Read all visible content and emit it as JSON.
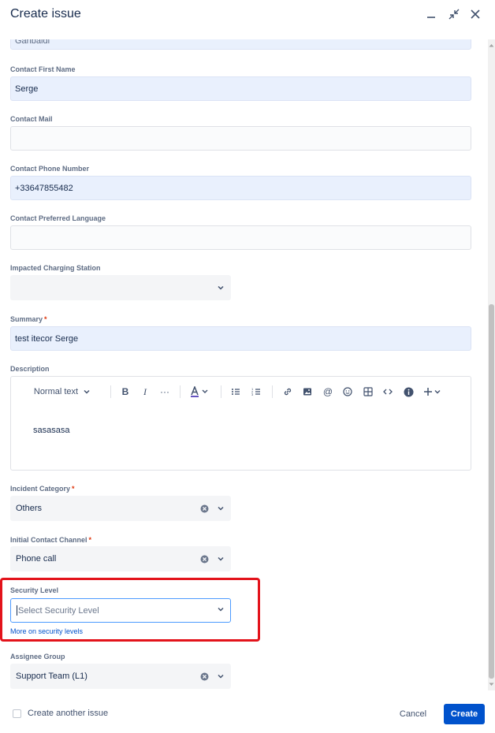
{
  "dialog": {
    "title": "Create issue"
  },
  "fields": {
    "partial_value": "Garibaldi",
    "contact_first_name": {
      "label": "Contact First Name",
      "value": "Serge"
    },
    "contact_mail": {
      "label": "Contact Mail",
      "value": ""
    },
    "contact_phone": {
      "label": "Contact Phone Number",
      "value": "+33647855482"
    },
    "contact_language": {
      "label": "Contact Preferred Language",
      "value": ""
    },
    "charging_station": {
      "label": "Impacted Charging Station",
      "value": ""
    },
    "summary": {
      "label": "Summary",
      "required": "*",
      "value": "test itecor Serge"
    },
    "description": {
      "label": "Description",
      "value": "sasasasa"
    },
    "incident_category": {
      "label": "Incident Category",
      "required": "*",
      "value": "Others"
    },
    "contact_channel": {
      "label": "Initial Contact Channel",
      "required": "*",
      "value": "Phone call"
    },
    "security_level": {
      "label": "Security Level",
      "placeholder": "Select Security Level",
      "link": "More on security levels"
    },
    "assignee_group": {
      "label": "Assignee Group",
      "value": "Support Team (L1)"
    }
  },
  "editor_toolbar": {
    "text_style": "Normal text",
    "icons": [
      "bold-icon",
      "italic-icon",
      "more-formatting-icon",
      "text-color-icon",
      "bullet-list-icon",
      "numbered-list-icon",
      "link-icon",
      "image-icon",
      "mention-icon",
      "emoji-icon",
      "table-icon",
      "code-icon",
      "info-icon",
      "insert-plus-icon"
    ]
  },
  "footer": {
    "create_another": "Create another issue",
    "cancel": "Cancel",
    "create": "Create"
  },
  "colors": {
    "accent": "#0052cc",
    "highlight": "#e3131b",
    "filled_bg": "#e9f0fd"
  }
}
